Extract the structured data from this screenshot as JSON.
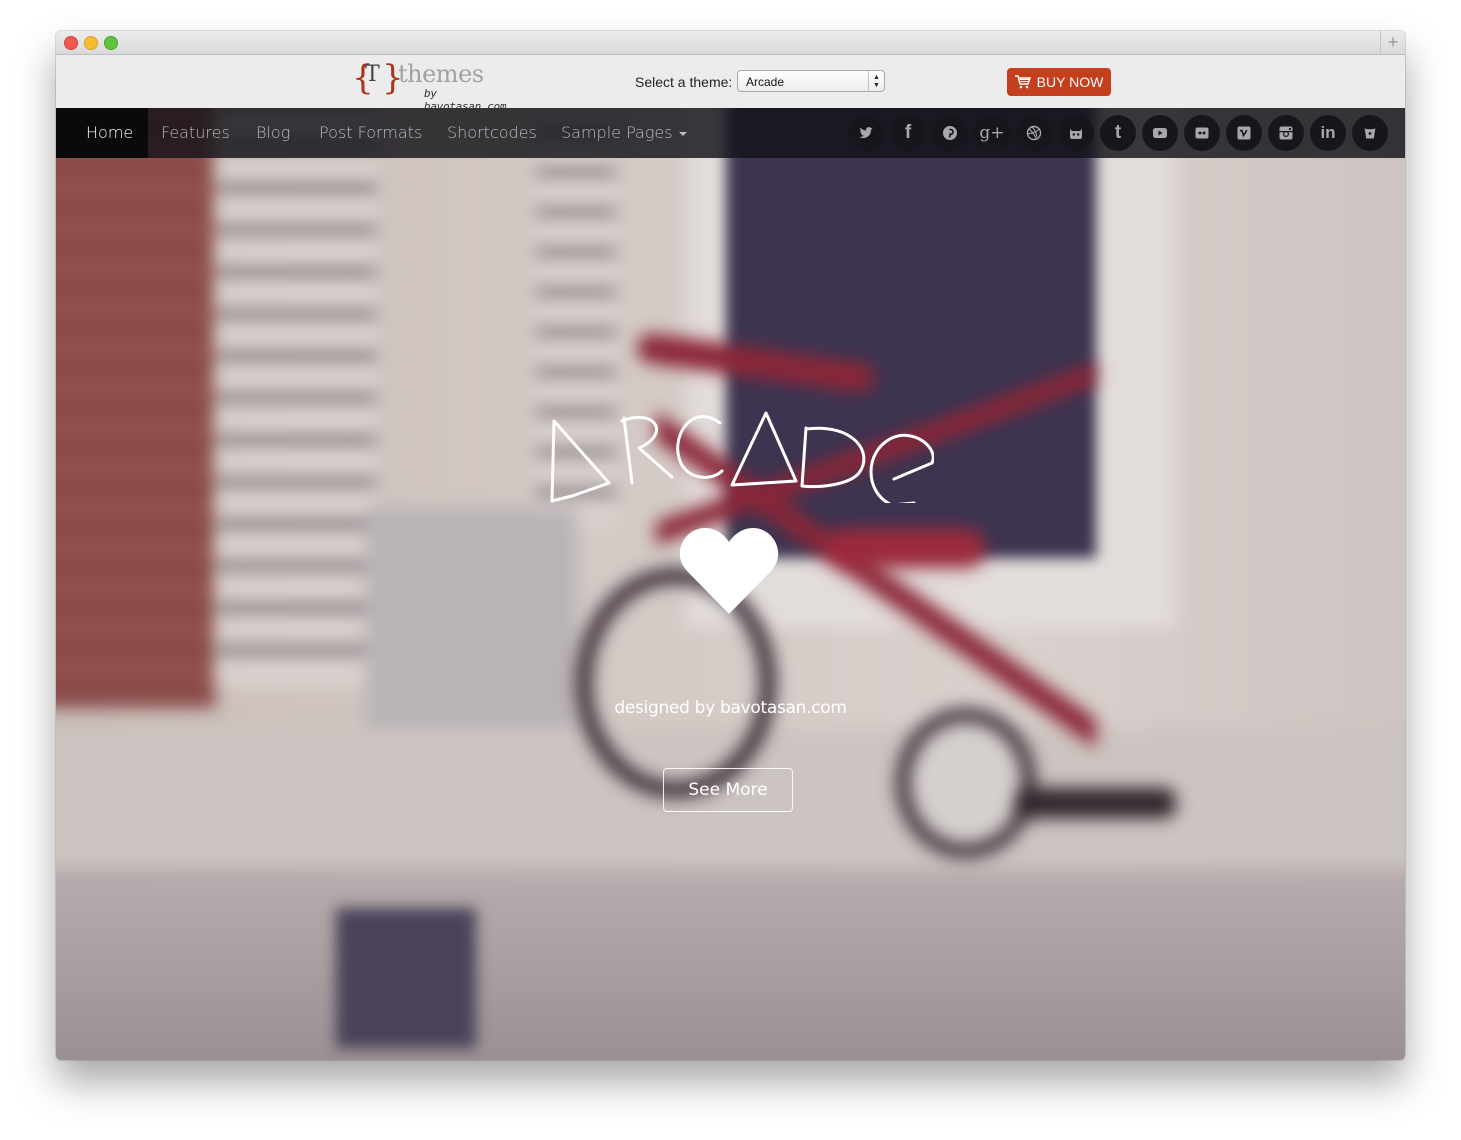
{
  "browser": {
    "new_tab_label": "+"
  },
  "topbar": {
    "logo": {
      "brace_left": "{",
      "brace_right": "}",
      "letter": "T",
      "wordmark": "themes",
      "byline": "by bavotasan.com"
    },
    "theme_select": {
      "label": "Select a theme:",
      "selected": "Arcade"
    },
    "buy_now": {
      "label": "BUY NOW",
      "icon": "cart-icon",
      "color": "#c43f1d"
    }
  },
  "nav": {
    "items": [
      {
        "label": "Home",
        "active": true
      },
      {
        "label": "Features"
      },
      {
        "label": "Blog"
      },
      {
        "label": "Post Formats"
      },
      {
        "label": "Shortcodes"
      },
      {
        "label": "Sample Pages",
        "has_dropdown": true
      }
    ],
    "social": [
      {
        "name": "twitter-icon",
        "glyph": "🐦"
      },
      {
        "name": "facebook-icon",
        "glyph": "f"
      },
      {
        "name": "pinterest-icon",
        "glyph": "p"
      },
      {
        "name": "google-plus-icon",
        "glyph": "g+"
      },
      {
        "name": "dribbble-icon",
        "glyph": "◎"
      },
      {
        "name": "github-icon",
        "glyph": "gh"
      },
      {
        "name": "tumblr-icon",
        "glyph": "t"
      },
      {
        "name": "youtube-icon",
        "glyph": "▶"
      },
      {
        "name": "flickr-icon",
        "glyph": "••"
      },
      {
        "name": "vimeo-icon",
        "glyph": "v"
      },
      {
        "name": "instagram-icon",
        "glyph": "◙"
      },
      {
        "name": "linkedin-icon",
        "glyph": "in"
      },
      {
        "name": "bitbucket-icon",
        "glyph": "⛁"
      }
    ]
  },
  "hero": {
    "title": "ARCADE",
    "icon": "heart-icon",
    "tagline": "designed by bavotasan.com",
    "cta_label": "See More"
  }
}
